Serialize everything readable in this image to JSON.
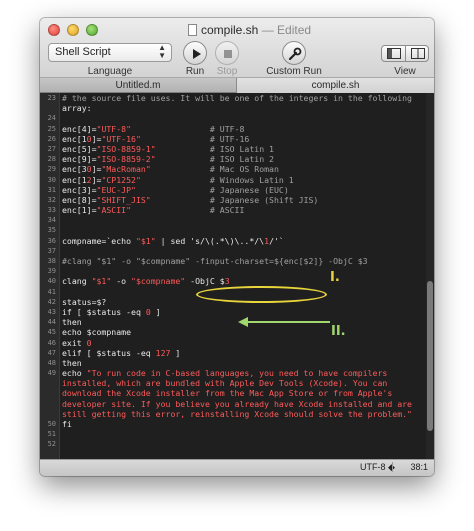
{
  "window": {
    "title": "compile.sh",
    "edited_suffix": "— Edited"
  },
  "toolbar": {
    "language_value": "Shell Script",
    "language_label": "Language",
    "run_label": "Run",
    "stop_label": "Stop",
    "custom_run_label": "Custom Run",
    "view_label": "View"
  },
  "tabs": [
    {
      "label": "Untitled.m",
      "active": false
    },
    {
      "label": "compile.sh",
      "active": true
    }
  ],
  "code": {
    "lines": [
      {
        "num": "23",
        "text": "# the source file uses. It will be one of the integers in the following"
      },
      {
        "num": "",
        "text": "array:"
      },
      {
        "num": "24",
        "text": ""
      },
      {
        "num": "25",
        "text": "enc[4]=\"UTF-8\"                # UTF-8"
      },
      {
        "num": "26",
        "text": "enc[10]=\"UTF-16\"              # UTF-16"
      },
      {
        "num": "27",
        "text": "enc[5]=\"ISO-8859-1\"           # ISO Latin 1"
      },
      {
        "num": "28",
        "text": "enc[9]=\"ISO-8859-2\"           # ISO Latin 2"
      },
      {
        "num": "29",
        "text": "enc[30]=\"MacRoman\"            # Mac OS Roman"
      },
      {
        "num": "30",
        "text": "enc[12]=\"CP1252\"              # Windows Latin 1"
      },
      {
        "num": "31",
        "text": "enc[3]=\"EUC-JP\"               # Japanese (EUC)"
      },
      {
        "num": "32",
        "text": "enc[8]=\"SHIFT_JIS\"            # Japanese (Shift JIS)"
      },
      {
        "num": "33",
        "text": "enc[1]=\"ASCII\"                # ASCII"
      },
      {
        "num": "34",
        "text": ""
      },
      {
        "num": "35",
        "text": ""
      },
      {
        "num": "36",
        "text": "compname=`echo \"$1\" | sed 's/\\(.*\\)\\..*/\\1/'`"
      },
      {
        "num": "37",
        "text": ""
      },
      {
        "num": "38",
        "text": "#clang \"$1\" -o \"$compname\" -finput-charset=${enc[$2]} -ObjC $3"
      },
      {
        "num": "39",
        "text": ""
      },
      {
        "num": "40",
        "text": "clang \"$1\" -o \"$compname\" -ObjC $3"
      },
      {
        "num": "41",
        "text": ""
      },
      {
        "num": "42",
        "text": "status=$?"
      },
      {
        "num": "43",
        "text": "if [ $status -eq 0 ]"
      },
      {
        "num": "44",
        "text": "then"
      },
      {
        "num": "45",
        "text": "echo $compname"
      },
      {
        "num": "46",
        "text": "exit 0"
      },
      {
        "num": "47",
        "text": "elif [ $status -eq 127 ]"
      },
      {
        "num": "48",
        "text": "then"
      },
      {
        "num": "49",
        "text": "echo \"To run code in C-based languages, you need to have compilers"
      },
      {
        "num": "",
        "text": "installed, which are bundled with Apple Dev Tools (Xcode). You can"
      },
      {
        "num": "",
        "text": "download the Xcode installer from the Mac App Store or from Apple's"
      },
      {
        "num": "",
        "text": "developer site. If you believe you already have Xcode installed and are"
      },
      {
        "num": "",
        "text": "still getting this error, reinstalling Xcode should solve the problem.\""
      },
      {
        "num": "50",
        "text": "fi"
      },
      {
        "num": "51",
        "text": ""
      },
      {
        "num": "52",
        "text": ""
      }
    ]
  },
  "annotations": {
    "label_1": "I.",
    "label_2": "II.",
    "color_1": "#e8d53c",
    "color_2": "#9fd66d"
  },
  "status": {
    "encoding": "UTF-8 ◆",
    "position": "38:1"
  },
  "colors": {
    "editor_bg": "#1f1f1f",
    "string": "#ff5a5a",
    "comment": "#a0a0a0",
    "text": "#e8e8e8"
  }
}
